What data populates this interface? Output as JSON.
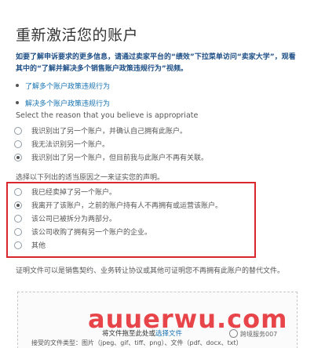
{
  "page": {
    "title": "重新激活您的账户",
    "intro": "如要了解申诉要求的更多信息，请通过卖家平台的“绩效”下拉菜单访问“卖家大学”，观看其中的“了解并解决多个销售账户政策违规行为”视频。",
    "links": [
      "了解多个账户政策违规行为",
      "解决多个账户政策违规行为"
    ]
  },
  "reason_section": {
    "label": "Select the reason that you believe is appropriate",
    "options": [
      {
        "text": "我识别出了另一个账户，并确认自己拥有此账户。",
        "checked": false
      },
      {
        "text": "我无法识别另一个账户。",
        "checked": false
      },
      {
        "text": "我识别出了另一个账户，但目前我与此账户不再有关联。",
        "checked": true
      }
    ]
  },
  "statement_section": {
    "label": "选择以下列出的适当原因之一来证实您的声明。",
    "options": [
      {
        "text": "我已经卖掉了另一个账户。",
        "checked": false
      },
      {
        "text": "我离开了该账户，之前的账户持有人不再拥有或运营该账户。",
        "checked": true
      },
      {
        "text": "该公司已被拆分为两部分。",
        "checked": false
      },
      {
        "text": "该公司收购了拥有另一个账户的企业。",
        "checked": false
      },
      {
        "text": "其他",
        "checked": false
      }
    ]
  },
  "upload": {
    "proof_text": "证明文件可以是销售契约、业务转让协议或其他可证明您不再拥有此账户的替代文件。",
    "drop_prefix": "将文件拖至此处或",
    "drop_link": "选择文件",
    "file_types": "接受的文件类型：图片（jpeg、gif、tiff、png）、文件（pdf、docx、txt）"
  },
  "watermark": {
    "text": "auuerwu.com",
    "small_text": "跨境服务007"
  },
  "colors": {
    "title": "#333333",
    "intro": "#1e4f86",
    "link": "#1a74b3",
    "highlight": "#d9262c",
    "watermark": "#e4181e"
  }
}
